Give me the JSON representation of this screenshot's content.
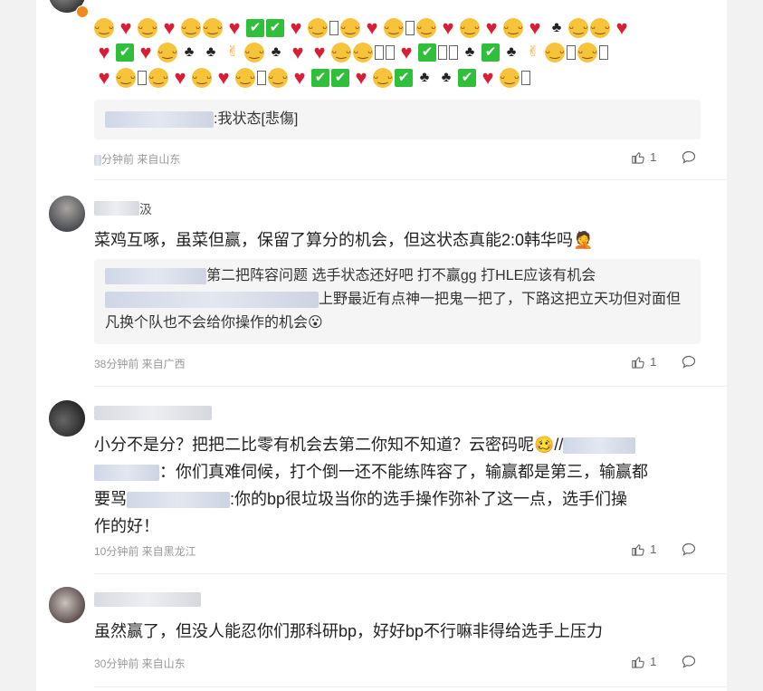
{
  "comments": [
    {
      "emoji_rows": [
        [
          "😋",
          "💓",
          "😋",
          "❤️",
          "😋",
          "😋",
          "❤️",
          "✅",
          "✅",
          "💓",
          "😋",
          "▯",
          "😋",
          "💓",
          "😋",
          "▯",
          "😋",
          "❤️",
          "😋",
          "❤️",
          "😋",
          "❤️",
          "🎃",
          "😋",
          "😋",
          "❤️"
        ],
        [
          "❤️",
          "✅",
          "❤️",
          "😋",
          "🎃",
          "🎃",
          "👌",
          "😋",
          "🎃",
          "❤️",
          "💓",
          "😋",
          "😋",
          "▯",
          "▯",
          "💓",
          "✅",
          "▯",
          "▯",
          "🎃",
          "✅",
          "🎃",
          "👌",
          "😋",
          "▯",
          "😋",
          "▯"
        ],
        [
          "💓",
          "😋",
          "▯",
          "😋",
          "💓",
          "😋",
          "💓",
          "😋",
          "▯",
          "😋",
          "❤️",
          "✅",
          "✅",
          "❤️",
          "😋",
          "✅",
          "🎃",
          "🎃",
          "✅",
          "❤️",
          "😋",
          "▯"
        ]
      ],
      "quote_text": ":我状态[悲傷]",
      "meta": "分钟前 来自山东",
      "likes": "1"
    },
    {
      "name_tail": "汲",
      "text": "菜鸡互啄，虽菜但赢，保留了算分的机会，但这状态真能2:0韩华吗🤦",
      "quote_line1": "第二把阵容问题 选手状态还好吧 打不赢gg 打HLE应该有机会",
      "quote_line2": "上野最近有点神一把鬼一把了，下路这把立天功但对面但凡换个队也不会给你操作的机会😮",
      "meta": "38分钟前 来自广西",
      "likes": "1"
    },
    {
      "text_line1": "小分不是分？把把二比零有机会去第二你知不知道？云密码呢🥴//",
      "text_line2": "：你们真难伺候，打个倒一还不能练阵容了，输赢都是第三，输赢都",
      "text_line3_a": "要骂",
      "text_line3_b": ":你的bp很垃圾当你的选手操作弥补了这一点，选手们操",
      "text_line4": "作的好！",
      "meta": "10分钟前 来自黑龙江",
      "likes": "1"
    },
    {
      "text": "虽然赢了，但没人能忍你们那科研bp，好好bp不行嘛非得给选手上压力",
      "meta": "30分钟前 来自山东",
      "likes": "1"
    }
  ],
  "icons": {
    "like": "thumbs-up-icon",
    "reply": "comment-icon"
  },
  "colors": {
    "meta": "#999999",
    "quote_bg": "#f5f5f5",
    "emoji_heart": "#d81e35",
    "emoji_check": "#2fbf3b"
  }
}
